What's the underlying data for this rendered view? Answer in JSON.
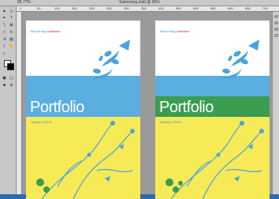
{
  "app": {
    "window_title": "Swimming.indd @ 85%",
    "title_left": "85.77%",
    "ruler_ticks": [
      "0",
      "50",
      "100",
      "150",
      "200",
      "250",
      "300",
      "350",
      "400",
      "450",
      "500",
      "550",
      "600",
      "650",
      "700"
    ]
  },
  "pages": [
    {
      "brand": "deluxe bag",
      "brand_tag": "collection",
      "title": "Portfolio",
      "subtitle": "Version 1/2016",
      "band_color": "#5aaee0"
    },
    {
      "brand": "deluxe bag",
      "brand_tag": "collection",
      "title": "Portfolio",
      "subtitle": "Version 1/2016",
      "band_color": "#3a9d4f"
    }
  ],
  "tools": [
    "selection-tool",
    "direct-selection-tool",
    "pen-tool",
    "type-tool",
    "line-tool",
    "frame-tool",
    "shape-tool",
    "rotate-tool",
    "scale-tool",
    "gradient-tool",
    "eyedropper-tool",
    "hand-tool",
    "zoom-tool"
  ]
}
